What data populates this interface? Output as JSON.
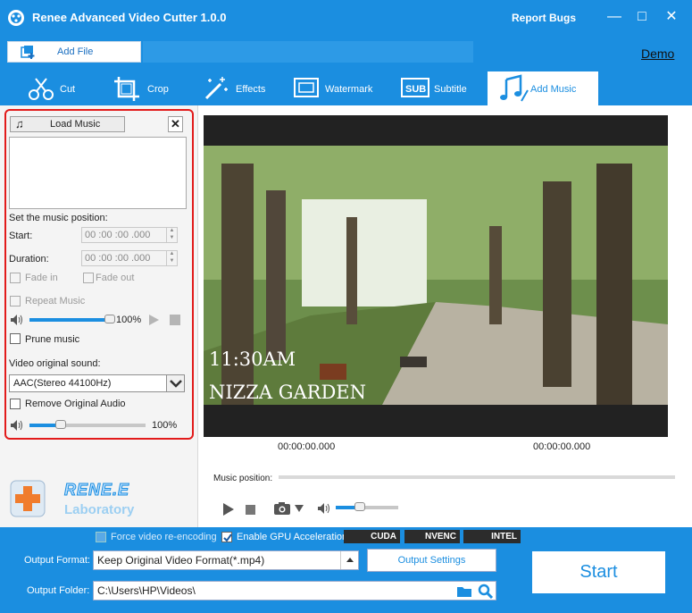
{
  "window": {
    "title": "Renee Advanced Video Cutter 1.0.0",
    "report_bugs": "Report Bugs",
    "minimize_glyph": "—",
    "maximize_glyph": "□",
    "close_glyph": "✕"
  },
  "toolbar": {
    "add_file_label": "Add File",
    "demo_link": "Demo"
  },
  "tabs": [
    {
      "label": "Cut",
      "icon": "scissors-icon"
    },
    {
      "label": "Crop",
      "icon": "crop-icon"
    },
    {
      "label": "Effects",
      "icon": "magic-wand-icon"
    },
    {
      "label": "Watermark",
      "icon": "watermark-icon"
    },
    {
      "label": "Subtitle",
      "icon": "subtitle-icon"
    },
    {
      "label": "Add Music",
      "icon": "music-note-icon",
      "active": true
    }
  ],
  "music_panel": {
    "load_music_label": "Load Music",
    "close_glyph": "✕",
    "set_position_label": "Set the music position:",
    "start_label": "Start:",
    "start_value": "00 :00 :00 .000",
    "duration_label": "Duration:",
    "duration_value": "00 :00 :00 .000",
    "fade_in_label": "Fade in",
    "fade_out_label": "Fade out",
    "repeat_music_label": "Repeat Music",
    "music_volume_value": "100%",
    "music_volume_level": 1.0,
    "prune_music_label": "Prune music",
    "video_sound_label": "Video original sound:",
    "video_sound_value": "AAC(Stereo 44100Hz)",
    "remove_audio_label": "Remove Original Audio",
    "original_volume_value": "100%",
    "original_volume_level": 0.27
  },
  "preview": {
    "overlay_time": "11:30AM",
    "overlay_place": "NIZZA GARDEN",
    "time_start": "00:00:00.000",
    "time_end": "00:00:00.000",
    "music_position_label": "Music position:",
    "player_volume_level": 0.38
  },
  "logo": {
    "line1": "RENE.E",
    "line2": "Laboratory"
  },
  "bottom": {
    "force_reencode_label": "Force video re-encoding",
    "gpu_label": "Enable GPU Acceleration",
    "gpu_badges": [
      "CUDA",
      "NVENC",
      "INTEL"
    ],
    "output_format_label": "Output Format:",
    "output_format_value": "Keep Original Video Format(*.mp4)",
    "output_settings_label": "Output Settings",
    "output_folder_label": "Output Folder:",
    "output_folder_value": "C:\\Users\\HP\\Videos\\",
    "start_label": "Start"
  },
  "colors": {
    "accent": "#1b8ee0",
    "highlight": "#e21b1b"
  }
}
